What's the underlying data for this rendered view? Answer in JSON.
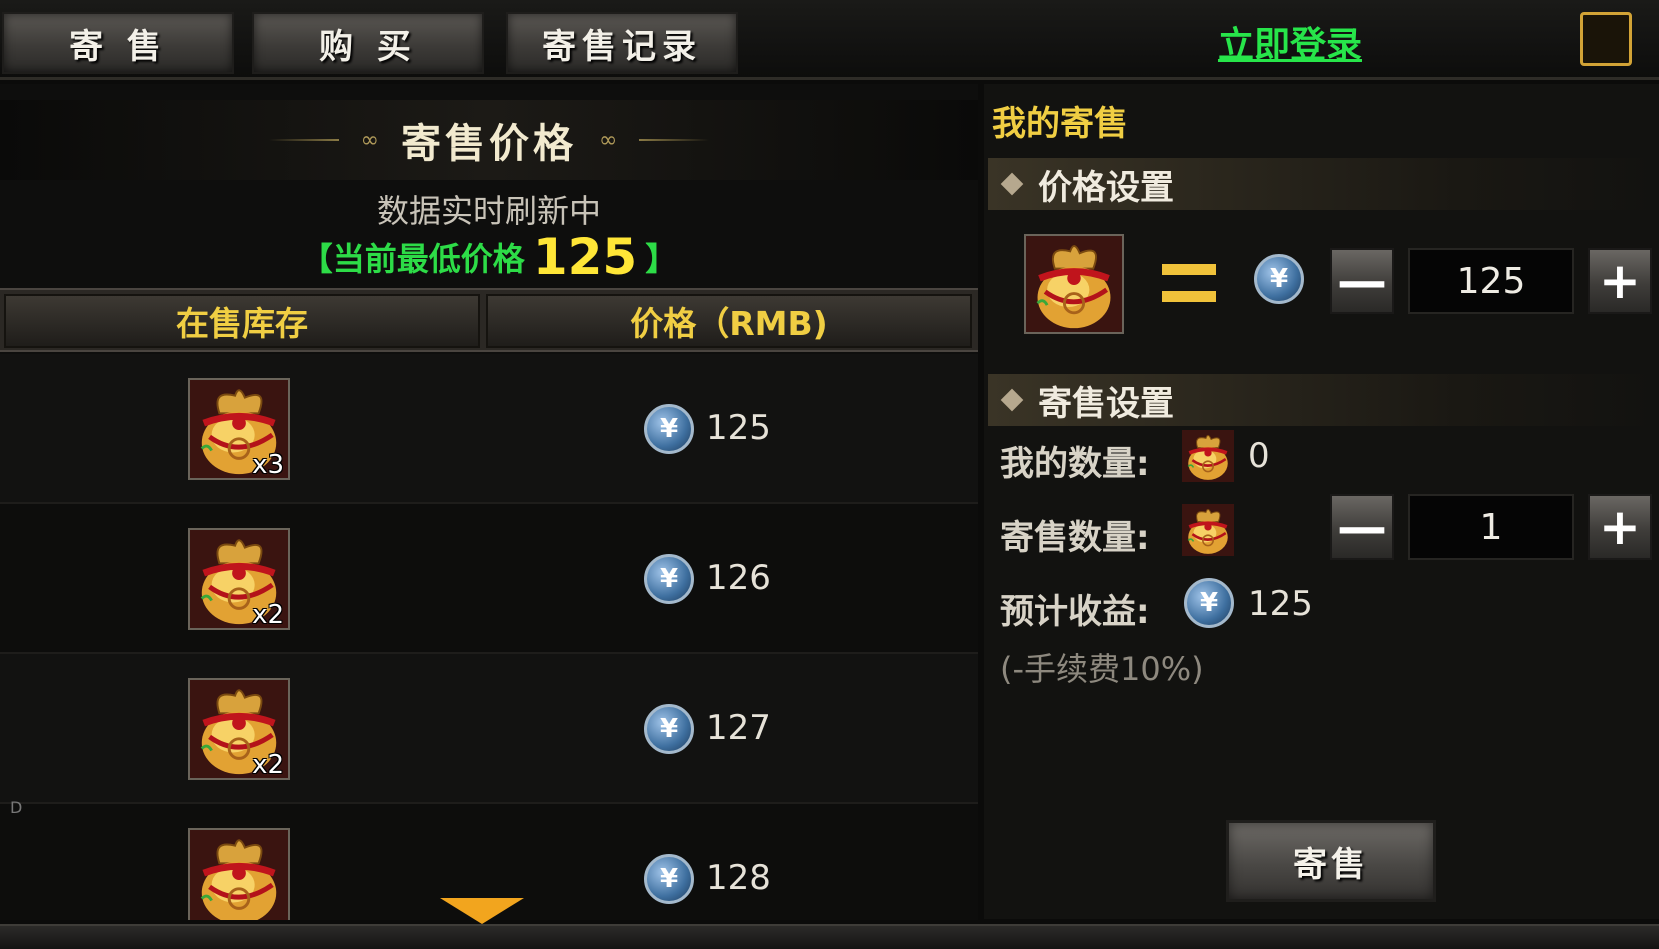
{
  "tabs": [
    {
      "label": "寄 售"
    },
    {
      "label": "购 买"
    },
    {
      "label": "寄售记录"
    }
  ],
  "login_link": "立即登录",
  "info_icon": "!",
  "price_panel": {
    "title": "寄售价格",
    "refresh_text": "数据实时刷新中",
    "lowest_prefix": "【当前最低价格",
    "lowest_value": "125",
    "lowest_suffix": "】",
    "columns": [
      "在售库存",
      "价格（RMB)"
    ],
    "rows": [
      {
        "qty": "x3",
        "price": "125"
      },
      {
        "qty": "x2",
        "price": "126"
      },
      {
        "qty": "x2",
        "price": "127"
      },
      {
        "qty": "",
        "price": "128"
      }
    ],
    "side_marker": "D"
  },
  "my_sale": {
    "title": "我的寄售",
    "price_section": "价格设置",
    "price_value": "125",
    "sale_section": "寄售设置",
    "my_qty_label": "我的数量:",
    "my_qty_value": "0",
    "sale_qty_label": "寄售数量:",
    "sale_qty_value": "1",
    "income_label": "预计收益:",
    "income_value": "125",
    "fee_note": "(-手续费10%)",
    "submit_label": "寄售"
  },
  "icons": {
    "coin": "¥",
    "minus": "—",
    "plus": "+",
    "item": "red-gold-treasure-bag"
  },
  "colors": {
    "accent_gold": "#f0ce43",
    "green_text": "#2ddc47",
    "yellow_value": "#ffe637",
    "login_green": "#27e54a"
  }
}
